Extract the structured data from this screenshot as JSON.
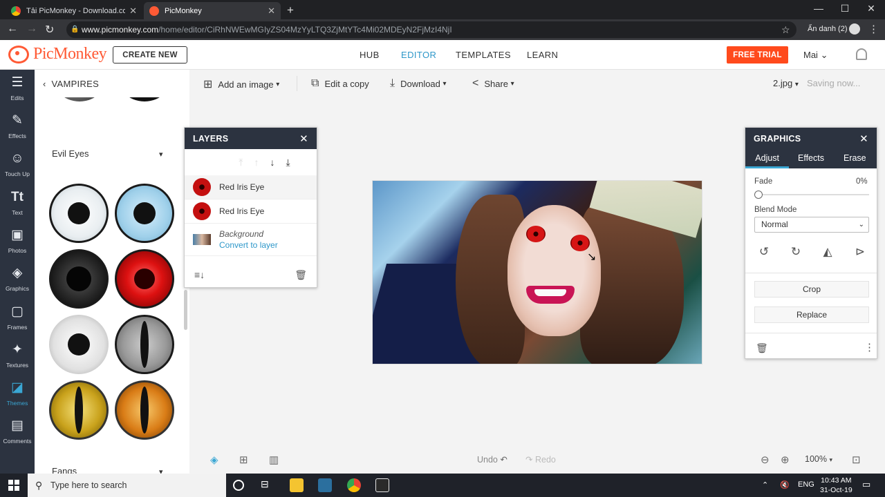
{
  "browser": {
    "tabs": [
      {
        "title": "Tải PicMonkey - Download.com.vn",
        "active": false
      },
      {
        "title": "PicMonkey",
        "active": true
      }
    ],
    "url_host": "www.picmonkey.com",
    "url_path": "/home/editor/CiRhNWEwMGIyZS04MzYyLTQ3ZjMtYTc4Mi02MDEyN2FjMzI4NjI",
    "profile_label": "Ẩn danh (2)"
  },
  "app": {
    "logo_text": "PicMonkey",
    "create_new": "CREATE NEW",
    "nav": [
      "HUB",
      "EDITOR",
      "TEMPLATES",
      "LEARN"
    ],
    "active_nav": "EDITOR",
    "free_trial": "FREE TRIAL",
    "user": "Mai",
    "accent": "#2d97c9",
    "brand": "#ff5a35"
  },
  "rail": [
    {
      "label": "Edits",
      "icon": "sliders-icon"
    },
    {
      "label": "Effects",
      "icon": "magic-wand-icon"
    },
    {
      "label": "Touch Up",
      "icon": "face-icon"
    },
    {
      "label": "Text",
      "icon": "text-icon"
    },
    {
      "label": "Photos",
      "icon": "camera-icon"
    },
    {
      "label": "Graphics",
      "icon": "shapes-icon"
    },
    {
      "label": "Frames",
      "icon": "frame-icon"
    },
    {
      "label": "Textures",
      "icon": "texture-icon"
    },
    {
      "label": "Themes",
      "icon": "theme-icon",
      "active": true
    },
    {
      "label": "Comments",
      "icon": "comment-icon"
    }
  ],
  "theme_panel": {
    "back_label": "VAMPIRES",
    "section_evil_eyes": "Evil Eyes",
    "section_fangs": "Fangs"
  },
  "toolbar": {
    "add_image": "Add an image",
    "edit_copy": "Edit a copy",
    "download": "Download",
    "share": "Share",
    "filename": "2.jpg",
    "status": "Saving now..."
  },
  "layers": {
    "title": "LAYERS",
    "items": [
      "Red Iris Eye",
      "Red Iris Eye"
    ],
    "background_label": "Background",
    "convert_label": "Convert to layer"
  },
  "graphics": {
    "title": "GRAPHICS",
    "tabs": [
      "Adjust",
      "Effects",
      "Erase"
    ],
    "active_tab": "Adjust",
    "fade_label": "Fade",
    "fade_value": "0%",
    "fade": 0,
    "blend_label": "Blend Mode",
    "blend_value": "Normal",
    "crop": "Crop",
    "replace": "Replace"
  },
  "bottom": {
    "undo": "Undo",
    "redo": "Redo",
    "zoom": "100%"
  },
  "taskbar": {
    "search_placeholder": "Type here to search",
    "lang": "ENG",
    "time": "10:43 AM",
    "date": "31-Oct-19"
  }
}
